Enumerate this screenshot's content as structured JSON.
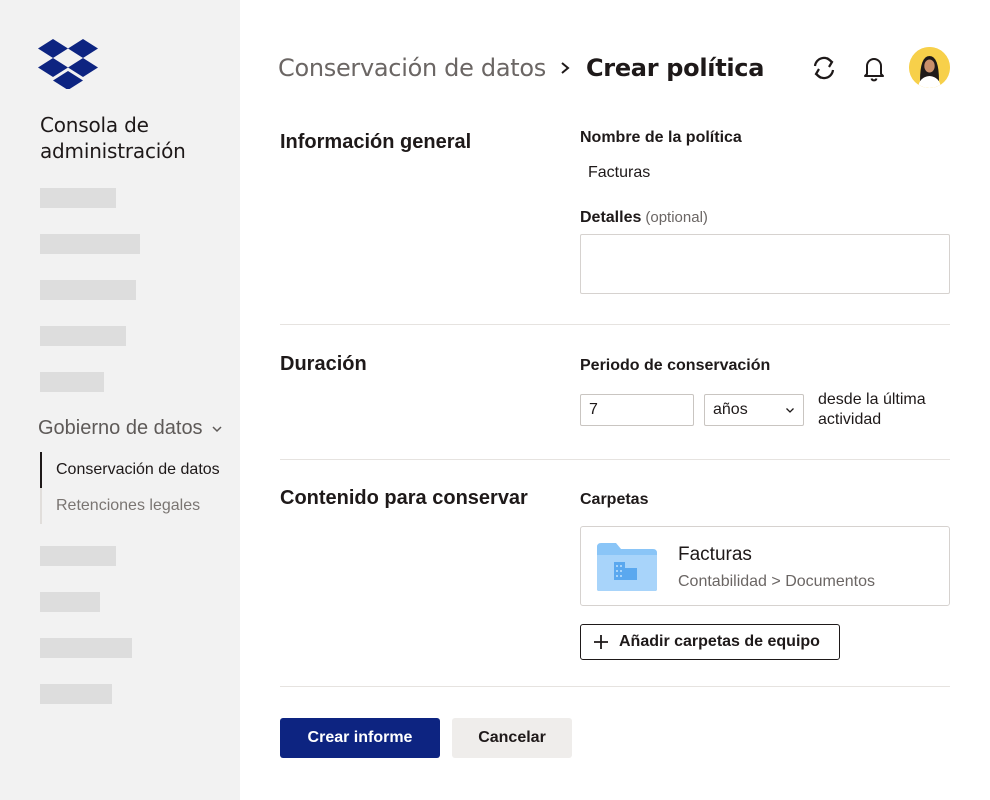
{
  "sidebar": {
    "console_title": "Consola de administración",
    "group": {
      "label": "Gobierno de datos",
      "items": [
        {
          "label": "Conservación de datos",
          "active": true
        },
        {
          "label": "Retenciones legales",
          "active": false
        }
      ]
    }
  },
  "header": {
    "breadcrumb_parent": "Conservación de datos",
    "breadcrumb_current": "Crear política",
    "icons": [
      "sync-icon",
      "bell-icon",
      "avatar"
    ]
  },
  "general": {
    "section_title": "Información general",
    "name_label": "Nombre de la política",
    "name_value": "Facturas",
    "details_label": "Detalles",
    "details_optional": "(optional)",
    "details_value": ""
  },
  "duration": {
    "section_title": "Duración",
    "period_label": "Periodo de conservación",
    "period_value": "7",
    "unit_value": "años",
    "since_text": "desde la última actividad"
  },
  "content": {
    "section_title": "Contenido para conservar",
    "folders_label": "Carpetas",
    "folder": {
      "name": "Facturas",
      "path": "Contabilidad > Documentos"
    },
    "add_button": "Añadir carpetas de equipo"
  },
  "actions": {
    "primary": "Crear informe",
    "secondary": "Cancelar"
  },
  "colors": {
    "brand_blue": "#0061fe",
    "primary_button": "#0d2481",
    "sidebar_bg": "#f2f2f2",
    "folder_blue": "#8ac5f7",
    "avatar_bg": "#f7d04a"
  }
}
